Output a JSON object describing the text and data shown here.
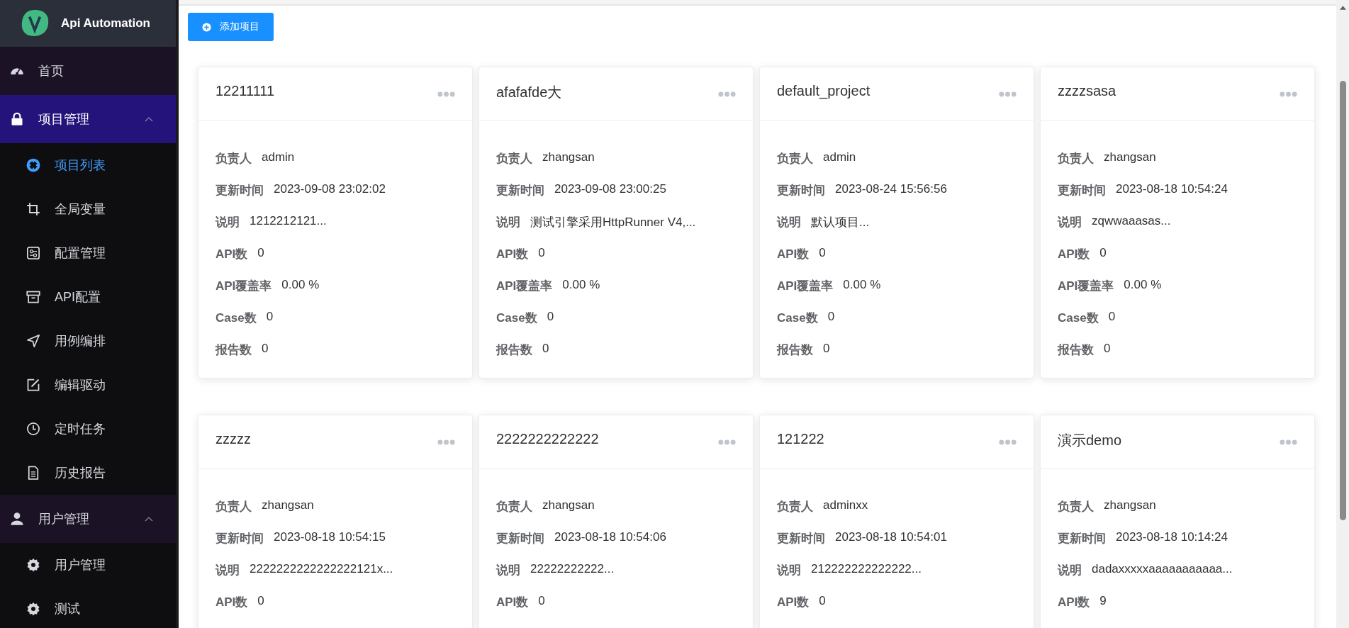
{
  "app": {
    "title": "Api Automation"
  },
  "sidebar": {
    "items": [
      {
        "label": "首页",
        "kind": "item",
        "selected": false
      },
      {
        "label": "项目管理",
        "kind": "group",
        "expanded": true,
        "selected": true,
        "children": [
          {
            "label": "项目列表",
            "selected": true
          },
          {
            "label": "全局变量",
            "selected": false
          },
          {
            "label": "配置管理",
            "selected": false
          },
          {
            "label": "API配置",
            "selected": false
          },
          {
            "label": "用例编排",
            "selected": false
          },
          {
            "label": "编辑驱动",
            "selected": false
          },
          {
            "label": "定时任务",
            "selected": false
          },
          {
            "label": "历史报告",
            "selected": false
          }
        ]
      },
      {
        "label": "用户管理",
        "kind": "group",
        "expanded": true,
        "selected": false,
        "children": [
          {
            "label": "用户管理",
            "selected": false
          },
          {
            "label": "测试",
            "selected": false
          }
        ]
      }
    ]
  },
  "toolbar": {
    "add_button": "添加项目"
  },
  "projects": [
    {
      "name": "12211111",
      "fields": [
        {
          "label": "负责人",
          "value": "admin"
        },
        {
          "label": "更新时间",
          "value": "2023-09-08 23:02:02"
        },
        {
          "label": "说明",
          "value": "1212212121..."
        },
        {
          "label": "API数",
          "value": "0"
        },
        {
          "label": "API覆盖率",
          "value": "0.00 %"
        },
        {
          "label": "Case数",
          "value": "0"
        },
        {
          "label": "报告数",
          "value": "0"
        }
      ]
    },
    {
      "name": "afafafde大",
      "fields": [
        {
          "label": "负责人",
          "value": "zhangsan"
        },
        {
          "label": "更新时间",
          "value": "2023-09-08 23:00:25"
        },
        {
          "label": "说明",
          "value": "测试引擎采用HttpRunner V4,..."
        },
        {
          "label": "API数",
          "value": "0"
        },
        {
          "label": "API覆盖率",
          "value": "0.00 %"
        },
        {
          "label": "Case数",
          "value": "0"
        },
        {
          "label": "报告数",
          "value": "0"
        }
      ]
    },
    {
      "name": "default_project",
      "fields": [
        {
          "label": "负责人",
          "value": "admin"
        },
        {
          "label": "更新时间",
          "value": "2023-08-24 15:56:56"
        },
        {
          "label": "说明",
          "value": "默认项目..."
        },
        {
          "label": "API数",
          "value": "0"
        },
        {
          "label": "API覆盖率",
          "value": "0.00 %"
        },
        {
          "label": "Case数",
          "value": "0"
        },
        {
          "label": "报告数",
          "value": "0"
        }
      ]
    },
    {
      "name": "zzzzsasa",
      "fields": [
        {
          "label": "负责人",
          "value": "zhangsan"
        },
        {
          "label": "更新时间",
          "value": "2023-08-18 10:54:24"
        },
        {
          "label": "说明",
          "value": "zqwwaaasas..."
        },
        {
          "label": "API数",
          "value": "0"
        },
        {
          "label": "API覆盖率",
          "value": "0.00 %"
        },
        {
          "label": "Case数",
          "value": "0"
        },
        {
          "label": "报告数",
          "value": "0"
        }
      ]
    },
    {
      "name": "zzzzz",
      "fields": [
        {
          "label": "负责人",
          "value": "zhangsan"
        },
        {
          "label": "更新时间",
          "value": "2023-08-18 10:54:15"
        },
        {
          "label": "说明",
          "value": "2222222222222222121x..."
        },
        {
          "label": "API数",
          "value": "0"
        }
      ]
    },
    {
      "name": "2222222222222",
      "fields": [
        {
          "label": "负责人",
          "value": "zhangsan"
        },
        {
          "label": "更新时间",
          "value": "2023-08-18 10:54:06"
        },
        {
          "label": "说明",
          "value": "22222222222..."
        },
        {
          "label": "API数",
          "value": "0"
        }
      ]
    },
    {
      "name": "121222",
      "fields": [
        {
          "label": "负责人",
          "value": "adminxx"
        },
        {
          "label": "更新时间",
          "value": "2023-08-18 10:54:01"
        },
        {
          "label": "说明",
          "value": "212222222222222..."
        },
        {
          "label": "API数",
          "value": "0"
        }
      ]
    },
    {
      "name": "演示demo",
      "fields": [
        {
          "label": "负责人",
          "value": "zhangsan"
        },
        {
          "label": "更新时间",
          "value": "2023-08-18 10:14:24"
        },
        {
          "label": "说明",
          "value": "dadaxxxxxaaaaaaaaaaa..."
        },
        {
          "label": "API数",
          "value": "9"
        }
      ]
    }
  ]
}
